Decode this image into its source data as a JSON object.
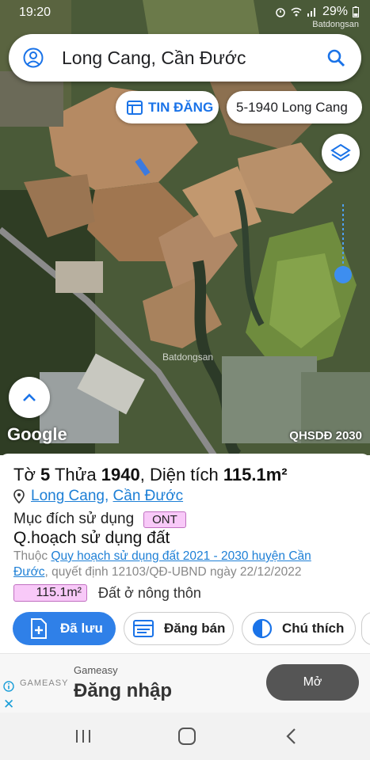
{
  "status_bar": {
    "time": "19:20",
    "battery": "29%",
    "watermark": "Batdongsan"
  },
  "search": {
    "query": "Long Cang, Cần Đước"
  },
  "chips": {
    "listings": "TIN ĐĂNG",
    "parcel": "5-1940 Long Cang"
  },
  "map": {
    "logo": "Google",
    "layer_label": "QHSDĐ 2030",
    "watermark": "Batdongsan"
  },
  "parcel": {
    "sheet_label": "Tờ",
    "sheet": "5",
    "lot_label": "Thửa",
    "lot": "1940",
    "area_label": "Diện tích",
    "area": "115.1m²",
    "commune": "Long Cang",
    "district": "Cần Đước",
    "purpose_label": "Mục đích sử dụng",
    "purpose_code": "ONT",
    "plan_title": "Q.hoạch sử dụng đất",
    "plan_prefix": "Thuộc",
    "plan_link": "Quy hoạch sử dụng đất 2021 - 2030 huyện Cần Đước",
    "plan_suffix": ", quyết định 12103/QĐ-UBND ngày 22/12/2022",
    "zone_area": "115.1m²",
    "zone_type": "Đất ở nông thôn"
  },
  "actions": {
    "saved": "Đã lưu",
    "sell": "Đăng bán",
    "legend": "Chú thích"
  },
  "ad": {
    "logo": "GAMEASY",
    "advertiser": "Gameasy",
    "headline": "Đăng nhập",
    "cta": "Mở"
  },
  "colors": {
    "primary": "#2f80e8",
    "link": "#1d7fd6",
    "badge_fill": "#f8c9f8",
    "ad_cta": "#555555"
  }
}
